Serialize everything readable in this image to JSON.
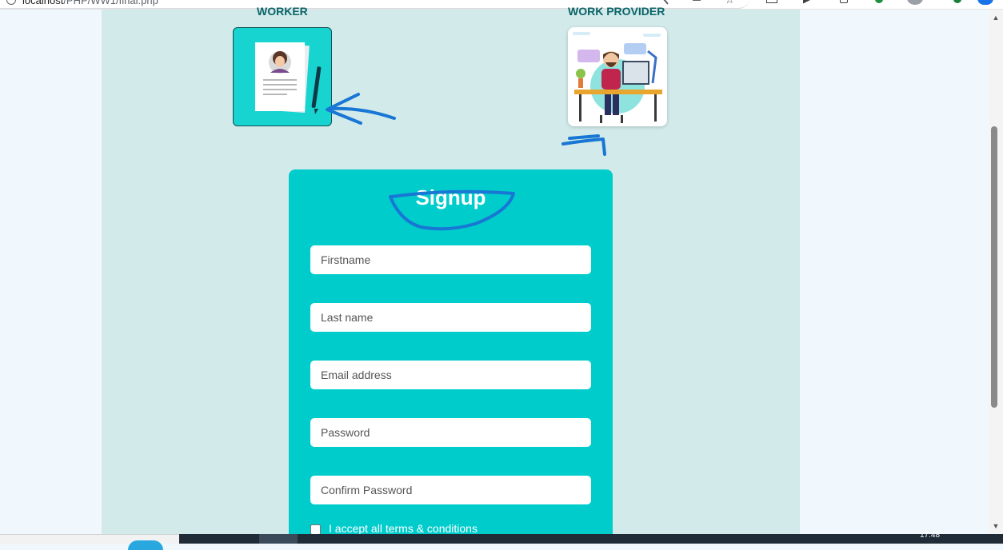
{
  "browser": {
    "url_host": "localhost",
    "url_path": "/PHP/WW1/final.php"
  },
  "roles": {
    "worker_title": "WORKER",
    "provider_title": "WORK PROVIDER"
  },
  "form": {
    "title": "Signup",
    "fields": [
      {
        "placeholder": "Firstname",
        "value": ""
      },
      {
        "placeholder": "Last name",
        "value": ""
      },
      {
        "placeholder": "Email address",
        "value": ""
      },
      {
        "placeholder": "Password",
        "value": ""
      },
      {
        "placeholder": "Confirm Password",
        "value": ""
      }
    ],
    "terms_label": "I accept all terms & conditions",
    "terms_checked": false
  },
  "taskbar": {
    "clock": "17:48"
  },
  "colors": {
    "page_bg": "#f0f8fd",
    "column_bg": "#d2eaea",
    "form_bg": "#00cccc",
    "title_color": "#0b6469",
    "annotation_ink": "#1877d4"
  },
  "icons": {
    "worker_card": "resume-document-icon",
    "provider_card": "person-at-desk-illustration"
  }
}
